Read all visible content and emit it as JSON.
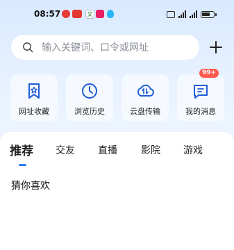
{
  "status_bar": {
    "time": "08:57",
    "notification_icons": [
      "weibo-icon",
      "news-icon",
      "text-icon",
      "app-icon",
      "qq-icon"
    ],
    "system_icons": [
      "nfc-icon",
      "signal-4g-icon",
      "signal-5g-icon",
      "battery-icon"
    ]
  },
  "search": {
    "placeholder": "输入关键词、口令或网址"
  },
  "quick_actions": [
    {
      "label": "网址收藏",
      "icon": "bookmark-icon"
    },
    {
      "label": "浏览历史",
      "icon": "clock-icon"
    },
    {
      "label": "云盘传输",
      "icon": "cloud-transfer-icon"
    },
    {
      "label": "我的消息",
      "icon": "message-icon",
      "badge": "99+"
    }
  ],
  "tabs": [
    {
      "label": "推荐",
      "active": true
    },
    {
      "label": "交友",
      "active": false
    },
    {
      "label": "直播",
      "active": false
    },
    {
      "label": "影院",
      "active": false
    },
    {
      "label": "游戏",
      "active": false
    }
  ],
  "section_title": "猜你喜欢",
  "colors": {
    "accent": "#2f7df6",
    "badge": "#ff5a4d",
    "background_top": "#d9e9ff"
  }
}
